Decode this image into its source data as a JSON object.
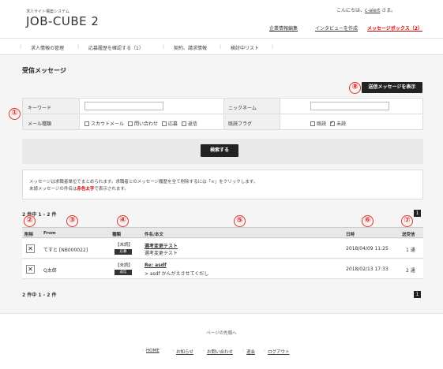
{
  "header": {
    "site_subtitle": "求人サイト構築システム",
    "logo": "JOB-CUBE 2",
    "greeting_prefix": "こんにちは、",
    "greeting_user": "c-alert",
    "greeting_suffix": " さま。",
    "links": [
      "企業情報編集",
      "インタビューを作成",
      "メッセージボックス（2）"
    ]
  },
  "nav": {
    "items": [
      "求人情報の管理",
      "応募履歴を確認する（1）",
      "契約、請求情報",
      "検討中リスト"
    ]
  },
  "page": {
    "title": "受信メッセージ",
    "sent_button": "送信メッセージを表示"
  },
  "markers": [
    "①",
    "②",
    "③",
    "④",
    "⑤",
    "⑥",
    "⑦",
    "⑧"
  ],
  "form": {
    "keyword_label": "キーワード",
    "nickname_label": "ニックネーム",
    "mail_type_label": "メール種類",
    "mail_types": [
      "スカウトメール",
      "問い合わせ",
      "応募",
      "返信"
    ],
    "read_flag_label": "既読フラグ",
    "read_flags": [
      {
        "label": "既読",
        "checked": false
      },
      {
        "label": "未読",
        "checked": true
      }
    ],
    "search_button": "検索する"
  },
  "notice": {
    "line1": "メッセージは求職者単位でまとめられます。求職者とのメッセージ履歴を全て削除するには「×」をクリックします。",
    "line2_prefix": "未読メッセージの件名は",
    "line2_highlight": "赤色太字",
    "line2_suffix": "で表示されます。"
  },
  "pagination": {
    "summary_top": "2 件中 1 - 2 件",
    "summary_bottom": "2 件中 1 - 2 件",
    "page": "1"
  },
  "table": {
    "headers": [
      "削除",
      "From",
      "種類",
      "件名/本文",
      "日時",
      "送受信"
    ],
    "rows": [
      {
        "delete": "✕",
        "from": "てすと [NB000022]",
        "status": "【未読】",
        "type": "応募",
        "subject": "選考変更テスト",
        "body": "選考変更テスト",
        "date": "2018/04/09 11:25",
        "count": "1 通"
      },
      {
        "delete": "✕",
        "from": "Q太郎",
        "status": "【未読】",
        "type": "返信",
        "subject": "Re: asdf",
        "body": "> asdf かんがえさせてくだし",
        "date": "2018/02/13 17:33",
        "count": "2 通"
      }
    ]
  },
  "footer": {
    "page_top": "ページの先頭へ",
    "links": [
      "HOME",
      "お知らせ",
      "お問い合わせ",
      "退会",
      "ログアウト"
    ]
  },
  "colors": {
    "accent_red": "#c00000",
    "marker_red": "#e0312b",
    "dark": "#222222"
  }
}
